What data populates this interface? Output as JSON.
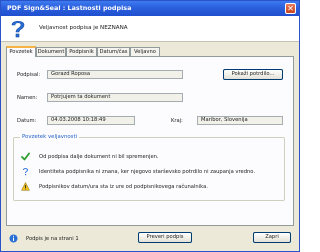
{
  "window": {
    "title": "PDF Sign&Seal : Lastnosti podpisa"
  },
  "header": {
    "message": "Veljavnost podpisa je NEZNANA",
    "icon": "question-icon"
  },
  "tabs": [
    {
      "label": "Povzetek",
      "active": true
    },
    {
      "label": "Dokument",
      "active": false
    },
    {
      "label": "Podpisnik",
      "active": false
    },
    {
      "label": "Datum/čas",
      "active": false
    },
    {
      "label": "Veljavno",
      "active": false
    }
  ],
  "summary": {
    "signer_label": "Podpisal:",
    "signer_value": "Gorazd Roposa",
    "show_cert_button": "Pokaži potrdilo...",
    "reason_label": "Namen:",
    "reason_value": "Potrjujem ta dokument",
    "date_label": "Datum:",
    "date_value": "04.03.2008 10:18:49",
    "location_label": "Kraj:",
    "location_value": "Maribor, Slovenija"
  },
  "validity": {
    "title": "Povzetek veljavnosti",
    "items": [
      {
        "icon": "checkmark-icon",
        "text": "Od podpisa dalje dokument ni bil spremenjen."
      },
      {
        "icon": "question-icon",
        "text": "Identiteta podpisnika ni znana, ker njegovo starševsko potrdilo ni zaupanja vredno."
      },
      {
        "icon": "warning-icon",
        "text": "Podpisnikov datum/ura sta iz ure od podpisnikovega računalnika."
      }
    ]
  },
  "footer": {
    "page_info": "Podpis je na strani 1",
    "preview_button": "Preveri podpis",
    "close_button": "Zapri"
  },
  "colors": {
    "title_bar": "#2b5fdc",
    "group_title": "#1f5fc5",
    "check": "#2e9e2e",
    "warning": "#f0c020"
  }
}
